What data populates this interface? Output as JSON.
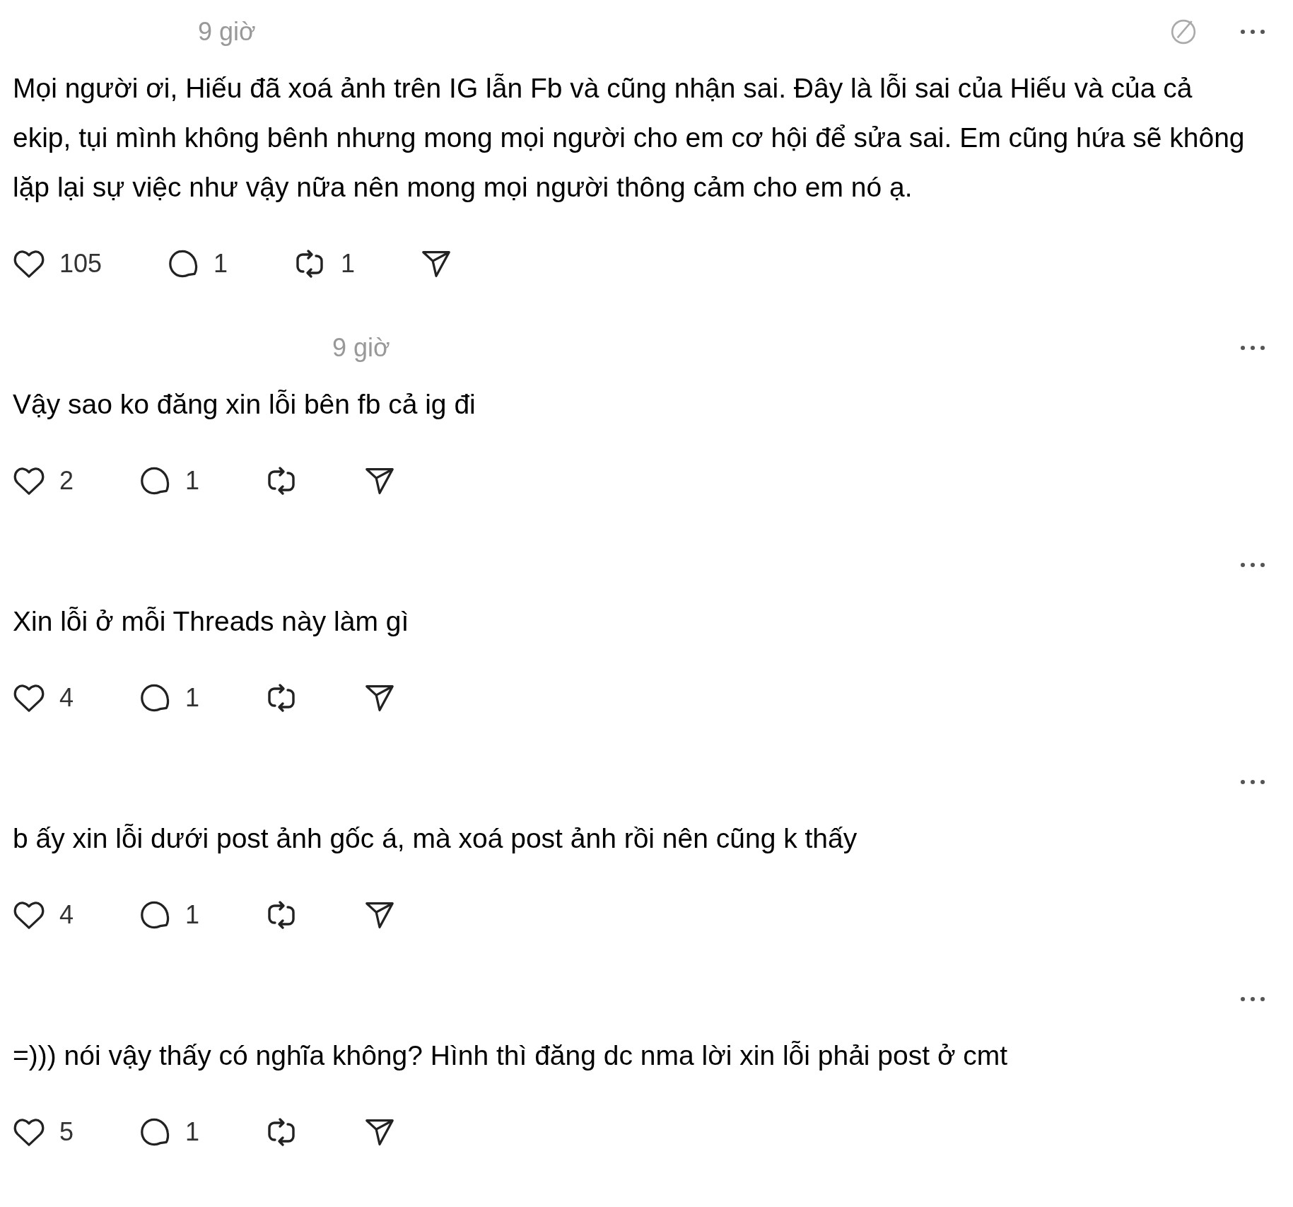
{
  "comments": [
    {
      "time": "9 giờ",
      "edited": true,
      "text": "Mọi người ơi, Hiếu đã xoá ảnh trên IG lẫn Fb và cũng nhận sai. Đây là lỗi sai của Hiếu và của cả ekip, tụi mình không bênh nhưng mong mọi người cho em cơ hội để sửa sai. Em cũng hứa sẽ không lặp lại sự việc như vậy nữa nên mong mọi người thông cảm cho em nó ạ.",
      "likes": "105",
      "replies": "1",
      "reposts": "1"
    },
    {
      "time": "9 giờ",
      "text": "Vậy sao ko đăng xin lỗi bên fb cả ig đi",
      "likes": "2",
      "replies": "1"
    },
    {
      "text": "Xin lỗi ở mỗi Threads này làm gì",
      "likes": "4",
      "replies": "1"
    },
    {
      "text": "b ấy xin lỗi dưới post ảnh gốc á, mà xoá post ảnh rồi nên cũng k thấy",
      "likes": "4",
      "replies": "1"
    },
    {
      "text": "=))) nói vậy thấy có nghĩa không? Hình thì đăng dc nma lời xin lỗi phải post ở cmt",
      "likes": "5",
      "replies": "1"
    }
  ]
}
